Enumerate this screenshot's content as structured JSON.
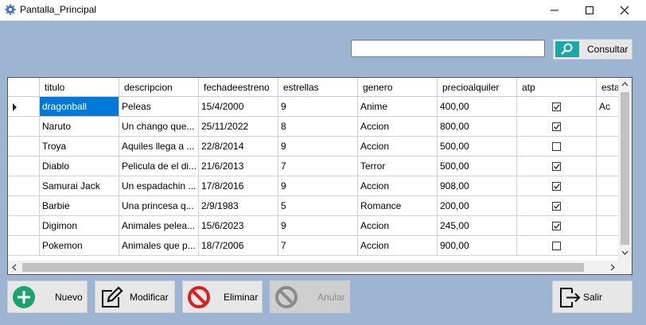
{
  "window": {
    "title": "Pantalla_Principal"
  },
  "search": {
    "value": "",
    "button_label": "Consultar"
  },
  "grid": {
    "columns": [
      "titulo",
      "descripcion",
      "fechadeestreno",
      "estrellas",
      "genero",
      "precioalquiler",
      "atp",
      "esta"
    ],
    "rows": [
      {
        "titulo": "dragonball",
        "descripcion": "Peleas",
        "fecha": "15/4/2000",
        "estrellas": "9",
        "genero": "Anime",
        "precio": "400,00",
        "atp": true,
        "extra": "Ac"
      },
      {
        "titulo": "Naruto",
        "descripcion": "Un chango que...",
        "fecha": "25/11/2022",
        "estrellas": "8",
        "genero": "Accion",
        "precio": "800,00",
        "atp": true,
        "extra": ""
      },
      {
        "titulo": "Troya",
        "descripcion": "Aquiles llega  a ...",
        "fecha": "22/8/2014",
        "estrellas": "9",
        "genero": "Accion",
        "precio": "500,00",
        "atp": false,
        "extra": ""
      },
      {
        "titulo": "Diablo",
        "descripcion": "Pelicula de el di...",
        "fecha": "21/6/2013",
        "estrellas": "7",
        "genero": "Terror",
        "precio": "500,00",
        "atp": true,
        "extra": ""
      },
      {
        "titulo": "Samurai Jack",
        "descripcion": "Un espadachin ...",
        "fecha": "17/8/2016",
        "estrellas": "9",
        "genero": "Accion",
        "precio": "908,00",
        "atp": true,
        "extra": ""
      },
      {
        "titulo": "Barbie",
        "descripcion": "Una princesa q...",
        "fecha": "2/9/1983",
        "estrellas": "5",
        "genero": "Romance",
        "precio": "200,00",
        "atp": true,
        "extra": ""
      },
      {
        "titulo": "Digimon",
        "descripcion": "Animales pelea...",
        "fecha": "15/6/2023",
        "estrellas": "9",
        "genero": "Accion",
        "precio": "245,00",
        "atp": true,
        "extra": ""
      },
      {
        "titulo": "Pokemon",
        "descripcion": "Animales que p...",
        "fecha": "18/7/2006",
        "estrellas": "7",
        "genero": "Accion",
        "precio": "900,00",
        "atp": false,
        "extra": ""
      }
    ]
  },
  "buttons": {
    "nuevo": "Nuevo",
    "modificar": "Modificar",
    "eliminar": "Eliminar",
    "anular": "Anular",
    "salir": "Salir"
  },
  "colors": {
    "background": "#9db4d2",
    "selection": "#0078d7",
    "accent": "#1ca6a6"
  }
}
